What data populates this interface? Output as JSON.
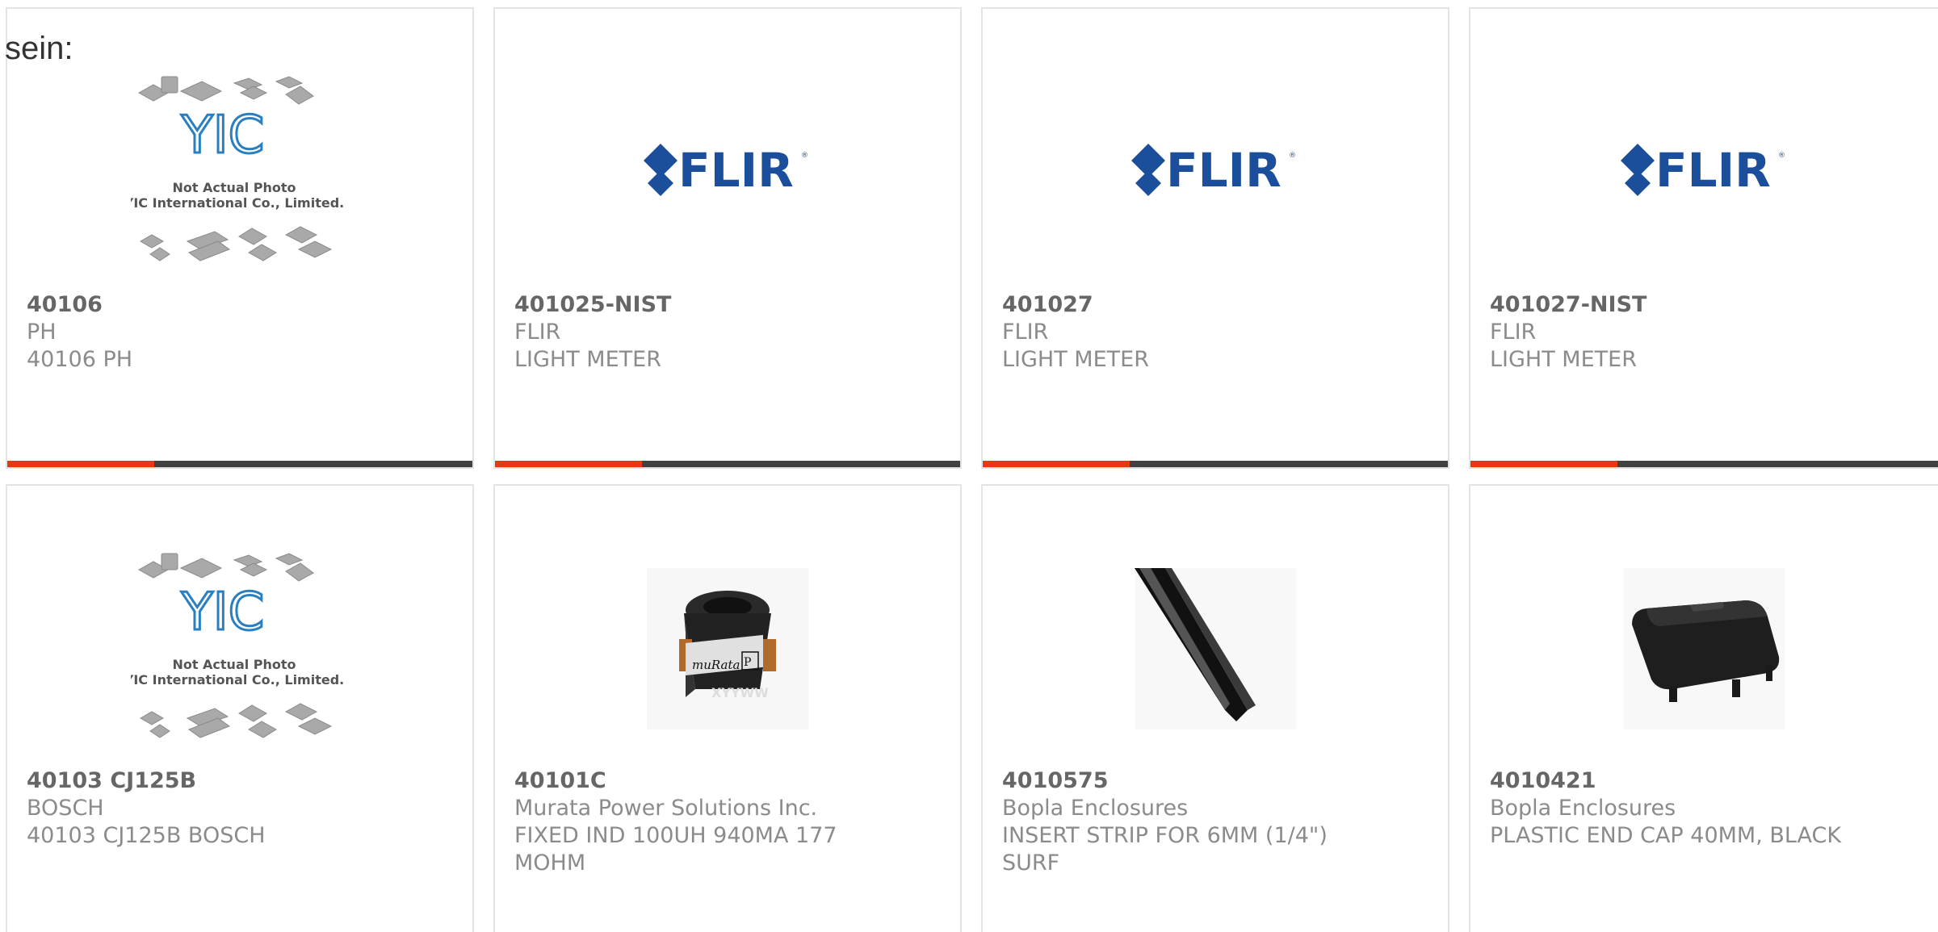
{
  "corner_text": "sein:",
  "brand_logo_text": "FLIR",
  "yic_logo": {
    "mark": "YIC",
    "line1": "Not Actual Photo",
    "line2": "YIC International Co., Limited."
  },
  "photo_labels": {
    "inductor_brand": "muRata",
    "inductor_code": "XYYWW"
  },
  "accent_color": "#e8380e",
  "bar_color": "#414141",
  "products": [
    {
      "part_number": "40106",
      "manufacturer": "PH",
      "description": "40106 PH",
      "image": "yic-placeholder"
    },
    {
      "part_number": "401025-NIST",
      "manufacturer": "FLIR",
      "description": "LIGHT METER",
      "image": "flir-logo"
    },
    {
      "part_number": "401027",
      "manufacturer": "FLIR",
      "description": "LIGHT METER",
      "image": "flir-logo"
    },
    {
      "part_number": "401027-NIST",
      "manufacturer": "FLIR",
      "description": "LIGHT METER",
      "image": "flir-logo"
    },
    {
      "part_number": "40103 CJ125B",
      "manufacturer": "BOSCH",
      "description": "40103 CJ125B BOSCH",
      "image": "yic-placeholder"
    },
    {
      "part_number": "40101C",
      "manufacturer": "Murata Power Solutions Inc.",
      "description": "FIXED IND 100UH 940MA 177 MOHM",
      "image": "inductor-photo"
    },
    {
      "part_number": "4010575",
      "manufacturer": "Bopla Enclosures",
      "description": "INSERT STRIP FOR 6MM (1/4\") SURF",
      "image": "insert-strip-photo"
    },
    {
      "part_number": "4010421",
      "manufacturer": "Bopla Enclosures",
      "description": "PLASTIC END CAP 40MM, BLACK",
      "image": "end-cap-photo"
    }
  ]
}
